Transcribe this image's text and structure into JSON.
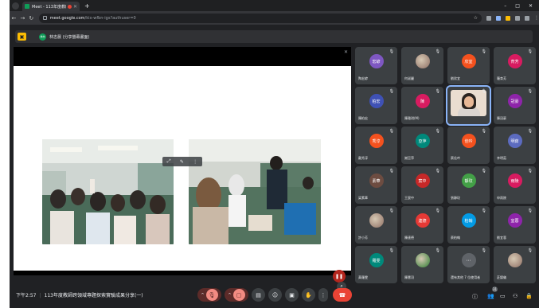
{
  "browser": {
    "tab_title": "Meet - 113年度教師專業發展...",
    "url_host": "meet.google.com",
    "url_path": "/kix-wfbn-igs?authuser=0"
  },
  "presenter": {
    "avatar_text": "林志",
    "label": "林志晨 (分享螢幕畫面)"
  },
  "participants": [
    {
      "avatar": "宏諺",
      "name": "陶宏諺",
      "color": "#7e57c2"
    },
    {
      "avatar": "",
      "name": "何淑麗",
      "color": "#8d6e63",
      "image": true
    },
    {
      "avatar": "欣宜",
      "name": "劉欣宜",
      "color": "#f4511e"
    },
    {
      "avatar": "育芳",
      "name": "羅育芳",
      "color": "#d81b60"
    },
    {
      "avatar": "柏宏",
      "name": "陳柏宏",
      "color": "#3f51b5"
    },
    {
      "avatar": "陳",
      "name": "陳雅琪(M)",
      "color": "#d81b60"
    },
    {
      "avatar": "",
      "name": "",
      "color": "#eaddd0",
      "video": true
    },
    {
      "avatar": "冠豪",
      "name": "陳冠豪",
      "color": "#8e24aa"
    },
    {
      "avatar": "秀淳",
      "name": "戴秀淳",
      "color": "#f4511e"
    },
    {
      "avatar": "亞萍",
      "name": "謝亞萍",
      "color": "#00897b"
    },
    {
      "avatar": "佳吟",
      "name": "蔡佳吟",
      "color": "#f4511e"
    },
    {
      "avatar": "明茹",
      "name": "李明茹",
      "color": "#5c6bc0"
    },
    {
      "avatar": "素華",
      "name": "梁素華",
      "color": "#6d4c41"
    },
    {
      "avatar": "宸中",
      "name": "王宸中",
      "color": "#c62828"
    },
    {
      "avatar": "靜玟",
      "name": "張靜玟",
      "color": "#43a047"
    },
    {
      "avatar": "雨陵",
      "name": "申雨陵",
      "color": "#d81b60"
    },
    {
      "avatar": "",
      "name": "許小芳",
      "color": "#8d6e63",
      "image": true
    },
    {
      "avatar": "連德",
      "name": "陳連德",
      "color": "#e53935"
    },
    {
      "avatar": "柏翰",
      "name": "蔡柏翰",
      "color": "#039be5"
    },
    {
      "avatar": "宜蓉",
      "name": "劉宜蓉",
      "color": "#8e24aa"
    },
    {
      "avatar": "羅雯",
      "name": "黃羅雯",
      "color": "#00897b"
    },
    {
      "avatar": "",
      "name": "陳慧羽",
      "color": "#2e7d32",
      "image": true
    },
    {
      "avatar": "",
      "name": "還有其他 7 位使用者",
      "color": "#3c4043",
      "more": true
    },
    {
      "avatar": "",
      "name": "莊錦儀",
      "color": "#8d6e63",
      "image": true
    }
  ],
  "bottom": {
    "time": "下午2:57",
    "meeting": "113年度教師跨領域專題探索實驗成果分享(一)",
    "participant_count": "31"
  },
  "colors": {
    "meet_bg": "#202124",
    "tile_bg": "#3c4043",
    "hangup": "#ea4335",
    "accent": "#8ab4f8"
  }
}
